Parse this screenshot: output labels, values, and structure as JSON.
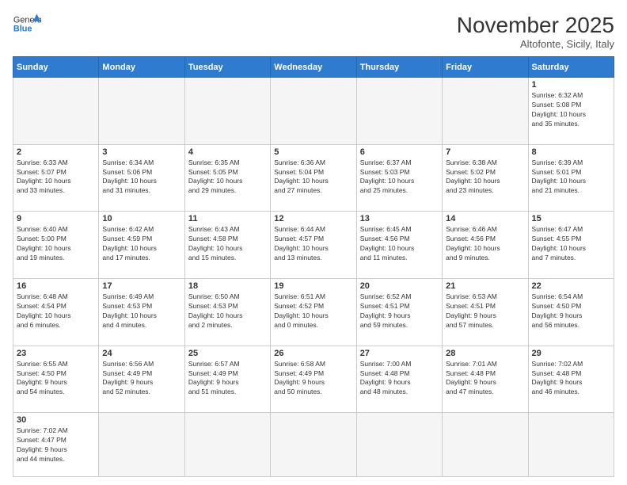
{
  "header": {
    "logo_general": "General",
    "logo_blue": "Blue",
    "month_title": "November 2025",
    "location": "Altofonte, Sicily, Italy"
  },
  "weekdays": [
    "Sunday",
    "Monday",
    "Tuesday",
    "Wednesday",
    "Thursday",
    "Friday",
    "Saturday"
  ],
  "weeks": [
    [
      {
        "day": "",
        "info": ""
      },
      {
        "day": "",
        "info": ""
      },
      {
        "day": "",
        "info": ""
      },
      {
        "day": "",
        "info": ""
      },
      {
        "day": "",
        "info": ""
      },
      {
        "day": "",
        "info": ""
      },
      {
        "day": "1",
        "info": "Sunrise: 6:32 AM\nSunset: 5:08 PM\nDaylight: 10 hours\nand 35 minutes."
      }
    ],
    [
      {
        "day": "2",
        "info": "Sunrise: 6:33 AM\nSunset: 5:07 PM\nDaylight: 10 hours\nand 33 minutes."
      },
      {
        "day": "3",
        "info": "Sunrise: 6:34 AM\nSunset: 5:06 PM\nDaylight: 10 hours\nand 31 minutes."
      },
      {
        "day": "4",
        "info": "Sunrise: 6:35 AM\nSunset: 5:05 PM\nDaylight: 10 hours\nand 29 minutes."
      },
      {
        "day": "5",
        "info": "Sunrise: 6:36 AM\nSunset: 5:04 PM\nDaylight: 10 hours\nand 27 minutes."
      },
      {
        "day": "6",
        "info": "Sunrise: 6:37 AM\nSunset: 5:03 PM\nDaylight: 10 hours\nand 25 minutes."
      },
      {
        "day": "7",
        "info": "Sunrise: 6:38 AM\nSunset: 5:02 PM\nDaylight: 10 hours\nand 23 minutes."
      },
      {
        "day": "8",
        "info": "Sunrise: 6:39 AM\nSunset: 5:01 PM\nDaylight: 10 hours\nand 21 minutes."
      }
    ],
    [
      {
        "day": "9",
        "info": "Sunrise: 6:40 AM\nSunset: 5:00 PM\nDaylight: 10 hours\nand 19 minutes."
      },
      {
        "day": "10",
        "info": "Sunrise: 6:42 AM\nSunset: 4:59 PM\nDaylight: 10 hours\nand 17 minutes."
      },
      {
        "day": "11",
        "info": "Sunrise: 6:43 AM\nSunset: 4:58 PM\nDaylight: 10 hours\nand 15 minutes."
      },
      {
        "day": "12",
        "info": "Sunrise: 6:44 AM\nSunset: 4:57 PM\nDaylight: 10 hours\nand 13 minutes."
      },
      {
        "day": "13",
        "info": "Sunrise: 6:45 AM\nSunset: 4:56 PM\nDaylight: 10 hours\nand 11 minutes."
      },
      {
        "day": "14",
        "info": "Sunrise: 6:46 AM\nSunset: 4:56 PM\nDaylight: 10 hours\nand 9 minutes."
      },
      {
        "day": "15",
        "info": "Sunrise: 6:47 AM\nSunset: 4:55 PM\nDaylight: 10 hours\nand 7 minutes."
      }
    ],
    [
      {
        "day": "16",
        "info": "Sunrise: 6:48 AM\nSunset: 4:54 PM\nDaylight: 10 hours\nand 6 minutes."
      },
      {
        "day": "17",
        "info": "Sunrise: 6:49 AM\nSunset: 4:53 PM\nDaylight: 10 hours\nand 4 minutes."
      },
      {
        "day": "18",
        "info": "Sunrise: 6:50 AM\nSunset: 4:53 PM\nDaylight: 10 hours\nand 2 minutes."
      },
      {
        "day": "19",
        "info": "Sunrise: 6:51 AM\nSunset: 4:52 PM\nDaylight: 10 hours\nand 0 minutes."
      },
      {
        "day": "20",
        "info": "Sunrise: 6:52 AM\nSunset: 4:51 PM\nDaylight: 9 hours\nand 59 minutes."
      },
      {
        "day": "21",
        "info": "Sunrise: 6:53 AM\nSunset: 4:51 PM\nDaylight: 9 hours\nand 57 minutes."
      },
      {
        "day": "22",
        "info": "Sunrise: 6:54 AM\nSunset: 4:50 PM\nDaylight: 9 hours\nand 56 minutes."
      }
    ],
    [
      {
        "day": "23",
        "info": "Sunrise: 6:55 AM\nSunset: 4:50 PM\nDaylight: 9 hours\nand 54 minutes."
      },
      {
        "day": "24",
        "info": "Sunrise: 6:56 AM\nSunset: 4:49 PM\nDaylight: 9 hours\nand 52 minutes."
      },
      {
        "day": "25",
        "info": "Sunrise: 6:57 AM\nSunset: 4:49 PM\nDaylight: 9 hours\nand 51 minutes."
      },
      {
        "day": "26",
        "info": "Sunrise: 6:58 AM\nSunset: 4:49 PM\nDaylight: 9 hours\nand 50 minutes."
      },
      {
        "day": "27",
        "info": "Sunrise: 7:00 AM\nSunset: 4:48 PM\nDaylight: 9 hours\nand 48 minutes."
      },
      {
        "day": "28",
        "info": "Sunrise: 7:01 AM\nSunset: 4:48 PM\nDaylight: 9 hours\nand 47 minutes."
      },
      {
        "day": "29",
        "info": "Sunrise: 7:02 AM\nSunset: 4:48 PM\nDaylight: 9 hours\nand 46 minutes."
      }
    ],
    [
      {
        "day": "30",
        "info": "Sunrise: 7:02 AM\nSunset: 4:47 PM\nDaylight: 9 hours\nand 44 minutes."
      },
      {
        "day": "",
        "info": ""
      },
      {
        "day": "",
        "info": ""
      },
      {
        "day": "",
        "info": ""
      },
      {
        "day": "",
        "info": ""
      },
      {
        "day": "",
        "info": ""
      },
      {
        "day": "",
        "info": ""
      }
    ]
  ]
}
